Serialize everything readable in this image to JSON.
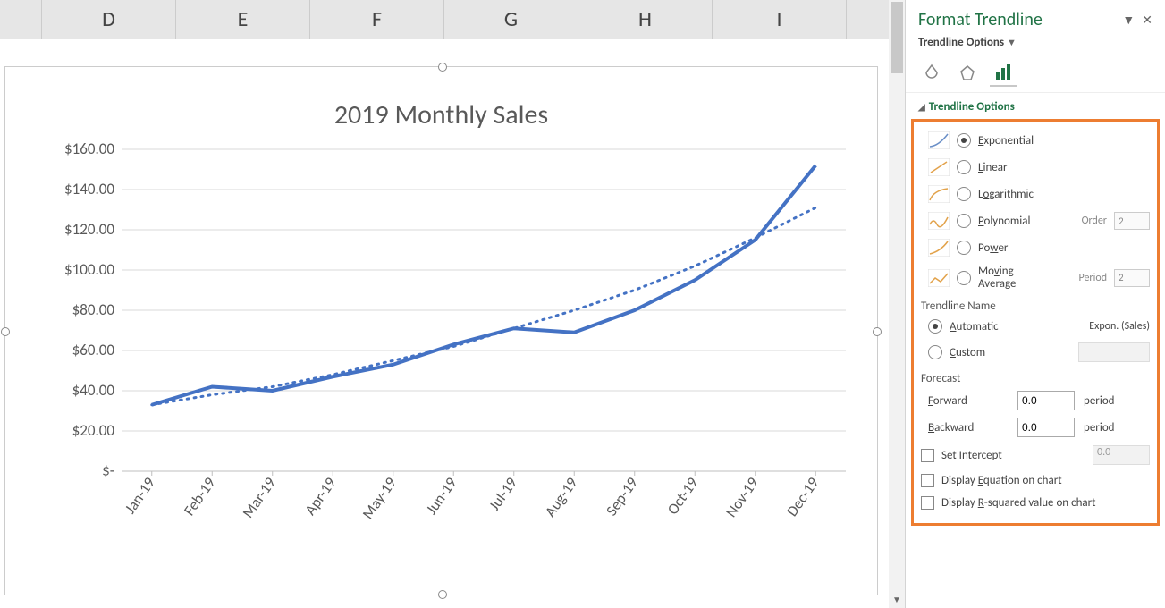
{
  "columns": [
    "D",
    "E",
    "F",
    "G",
    "H",
    "I"
  ],
  "pane": {
    "title": "Format Trendline",
    "sub": "Trendline Options",
    "section": "Trendline Options",
    "opts": {
      "exponential": "Exponential",
      "linear": "Linear",
      "logarithmic": "Logarithmic",
      "polynomial": "Polynomial",
      "power": "Power",
      "moving": "Moving Average",
      "order_label": "Order",
      "order_val": "2",
      "period_label": "Period",
      "period_val": "2",
      "selected": "exponential"
    },
    "name": {
      "title": "Trendline Name",
      "automatic": "Automatic",
      "custom": "Custom",
      "auto_value": "Expon. (Sales)"
    },
    "forecast": {
      "title": "Forecast",
      "forward": "Forward",
      "backward": "Backward",
      "fwd_val": "0.0",
      "bwd_val": "0.0",
      "unit": "period"
    },
    "intercept": {
      "label": "Set Intercept",
      "val": "0.0"
    },
    "disp_eq": "Display Equation on chart",
    "disp_r2": "Display R-squared value on chart"
  },
  "chart_data": {
    "type": "line",
    "title": "2019 Monthly Sales",
    "xlabel": "",
    "ylabel": "",
    "ylim": [
      0,
      160
    ],
    "y_ticks": [
      "$-",
      "$20.00",
      "$40.00",
      "$60.00",
      "$80.00",
      "$100.00",
      "$120.00",
      "$140.00",
      "$160.00"
    ],
    "categories": [
      "Jan-19",
      "Feb-19",
      "Mar-19",
      "Apr-19",
      "May-19",
      "Jun-19",
      "Jul-19",
      "Aug-19",
      "Sep-19",
      "Oct-19",
      "Nov-19",
      "Dec-19"
    ],
    "series": [
      {
        "name": "Sales",
        "style": "solid",
        "values": [
          33,
          42,
          40,
          47,
          53,
          63,
          71,
          69,
          80,
          95,
          115,
          152
        ]
      },
      {
        "name": "Expon. (Sales)",
        "style": "dotted",
        "values": [
          33,
          38,
          42,
          48,
          55,
          62,
          71,
          80,
          90,
          102,
          116,
          131
        ]
      }
    ]
  }
}
